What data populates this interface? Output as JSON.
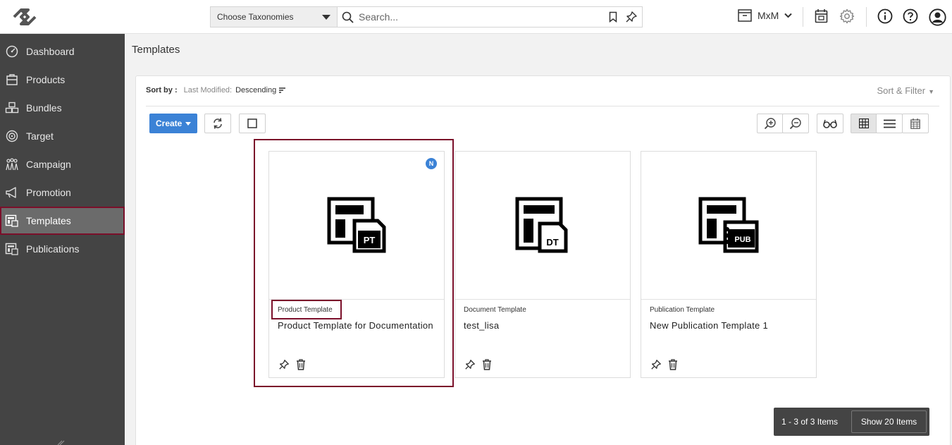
{
  "header": {
    "taxonomy_select": {
      "value": "Choose Taxonomies"
    },
    "search": {
      "placeholder": "Search..."
    },
    "workspace": {
      "label": "MxM"
    }
  },
  "sidebar": {
    "items": [
      {
        "label": "Dashboard",
        "icon": "dashboard-icon"
      },
      {
        "label": "Products",
        "icon": "products-icon"
      },
      {
        "label": "Bundles",
        "icon": "bundles-icon"
      },
      {
        "label": "Target",
        "icon": "target-icon"
      },
      {
        "label": "Campaign",
        "icon": "campaign-icon"
      },
      {
        "label": "Promotion",
        "icon": "megaphone-icon"
      },
      {
        "label": "Templates",
        "icon": "templates-icon",
        "active": true
      },
      {
        "label": "Publications",
        "icon": "publications-icon"
      }
    ]
  },
  "main": {
    "title": "Templates",
    "sort": {
      "label": "Sort by :",
      "field": "Last Modified:",
      "direction": "Descending"
    },
    "sort_filter_label": "Sort & Filter",
    "toolbar": {
      "create_label": "Create"
    },
    "cards": [
      {
        "type": "Product Template",
        "name": "Product Template for Documentation",
        "badge": "N",
        "icon_text": "PT"
      },
      {
        "type": "Document Template",
        "name": "test_lisa",
        "icon_text": "DT"
      },
      {
        "type": "Publication Template",
        "name": "New Publication Template 1",
        "icon_text": "PUB"
      }
    ],
    "pagination": {
      "range": "1 - 3 of 3 Items",
      "page_size": "Show 20 Items"
    }
  },
  "colors": {
    "accent": "#3b82d6",
    "sidebar_bg": "#444444",
    "highlight": "#7b0f2a"
  }
}
